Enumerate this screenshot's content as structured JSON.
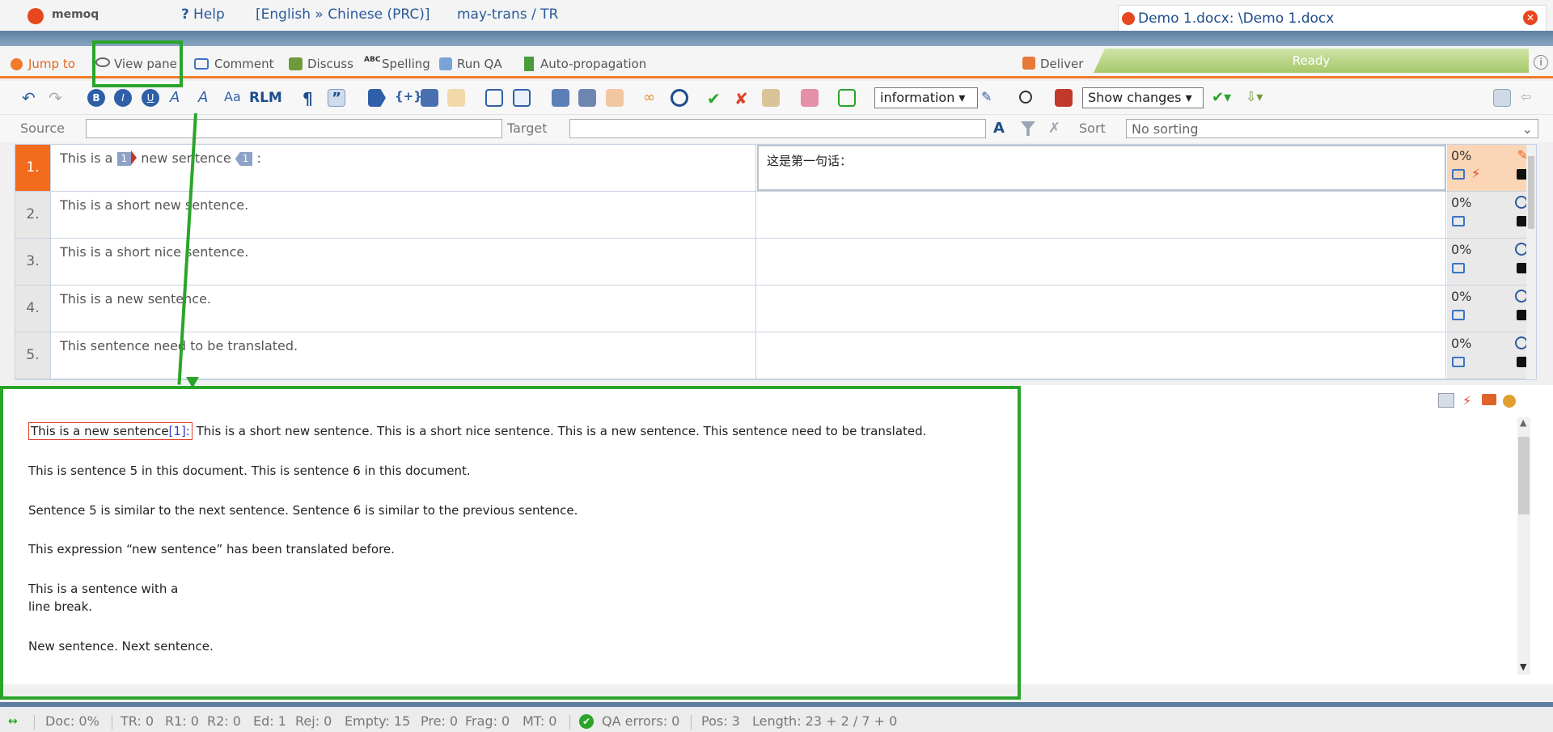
{
  "titlebar": {
    "logo": "memoq",
    "help": "Help",
    "lang_pair": "[English » Chinese (PRC)]",
    "project": "may-trans / TR",
    "doc_tab": "Demo 1.docx: \\Demo 1.docx"
  },
  "ribbon": {
    "jump_to": "Jump to",
    "view_pane": "View pane",
    "comment": "Comment",
    "discuss": "Discuss",
    "spelling": "Spelling",
    "run_qa": "Run QA",
    "auto_propagation": "Auto-propagation",
    "deliver": "Deliver",
    "ready": "Ready"
  },
  "toolbar": {
    "rlm": "RLM",
    "info_select": "information",
    "show_changes": "Show changes"
  },
  "filter": {
    "source_label": "Source",
    "target_label": "Target",
    "sort_label": "Sort",
    "sort_value": "No sorting"
  },
  "segments": [
    {
      "num": "1.",
      "source_pre": "This is a",
      "tag1": "1",
      "source_mid": "new sentence",
      "tag2": "1",
      "source_post": ":",
      "target": "这是第一句话：",
      "status": "0%"
    },
    {
      "num": "2.",
      "source": "This is a short new sentence.",
      "target": "",
      "status": "0%"
    },
    {
      "num": "3.",
      "source": "This is a short nice sentence.",
      "target": "",
      "status": "0%"
    },
    {
      "num": "4.",
      "source": "This is a new sentence.",
      "target": "",
      "status": "0%"
    },
    {
      "num": "5.",
      "source": "This sentence need to be translated.",
      "target": "",
      "status": "0%"
    }
  ],
  "preview": {
    "p1_highlight": "This is a new sentence",
    "p1_tag": "[1]:",
    "p1_rest": "This is a short new sentence. This is a short nice sentence. This is a new sentence. This sentence need to be translated.",
    "p2": "This is sentence 5 in this document. This is sentence 6 in this document.",
    "p3": "Sentence 5 is similar to the next sentence. Sentence 6 is similar to the previous sentence.",
    "p4": "This expression “new sentence” has been translated before.",
    "p5a": "This is a sentence with a",
    "p5b": "line break.",
    "p6": "New sentence. Next sentence."
  },
  "status": {
    "doc": "Doc: 0%",
    "tr": "TR: 0",
    "r1": "R1: 0",
    "r2": "R2: 0",
    "ed": "Ed: 1",
    "rej": "Rej: 0",
    "empty": "Empty: 15",
    "pre": "Pre: 0",
    "frag": "Frag: 0",
    "mt": "MT: 0",
    "qa_errors": "QA errors: 0",
    "pos": "Pos: 3",
    "length": "Length: 23 + 2 / 7 + 0"
  },
  "colors": {
    "accent_orange": "#f07a2a",
    "active_row": "#f26b1d",
    "annotation_green": "#2aa52a",
    "band_blue": "#5f7fa0"
  }
}
